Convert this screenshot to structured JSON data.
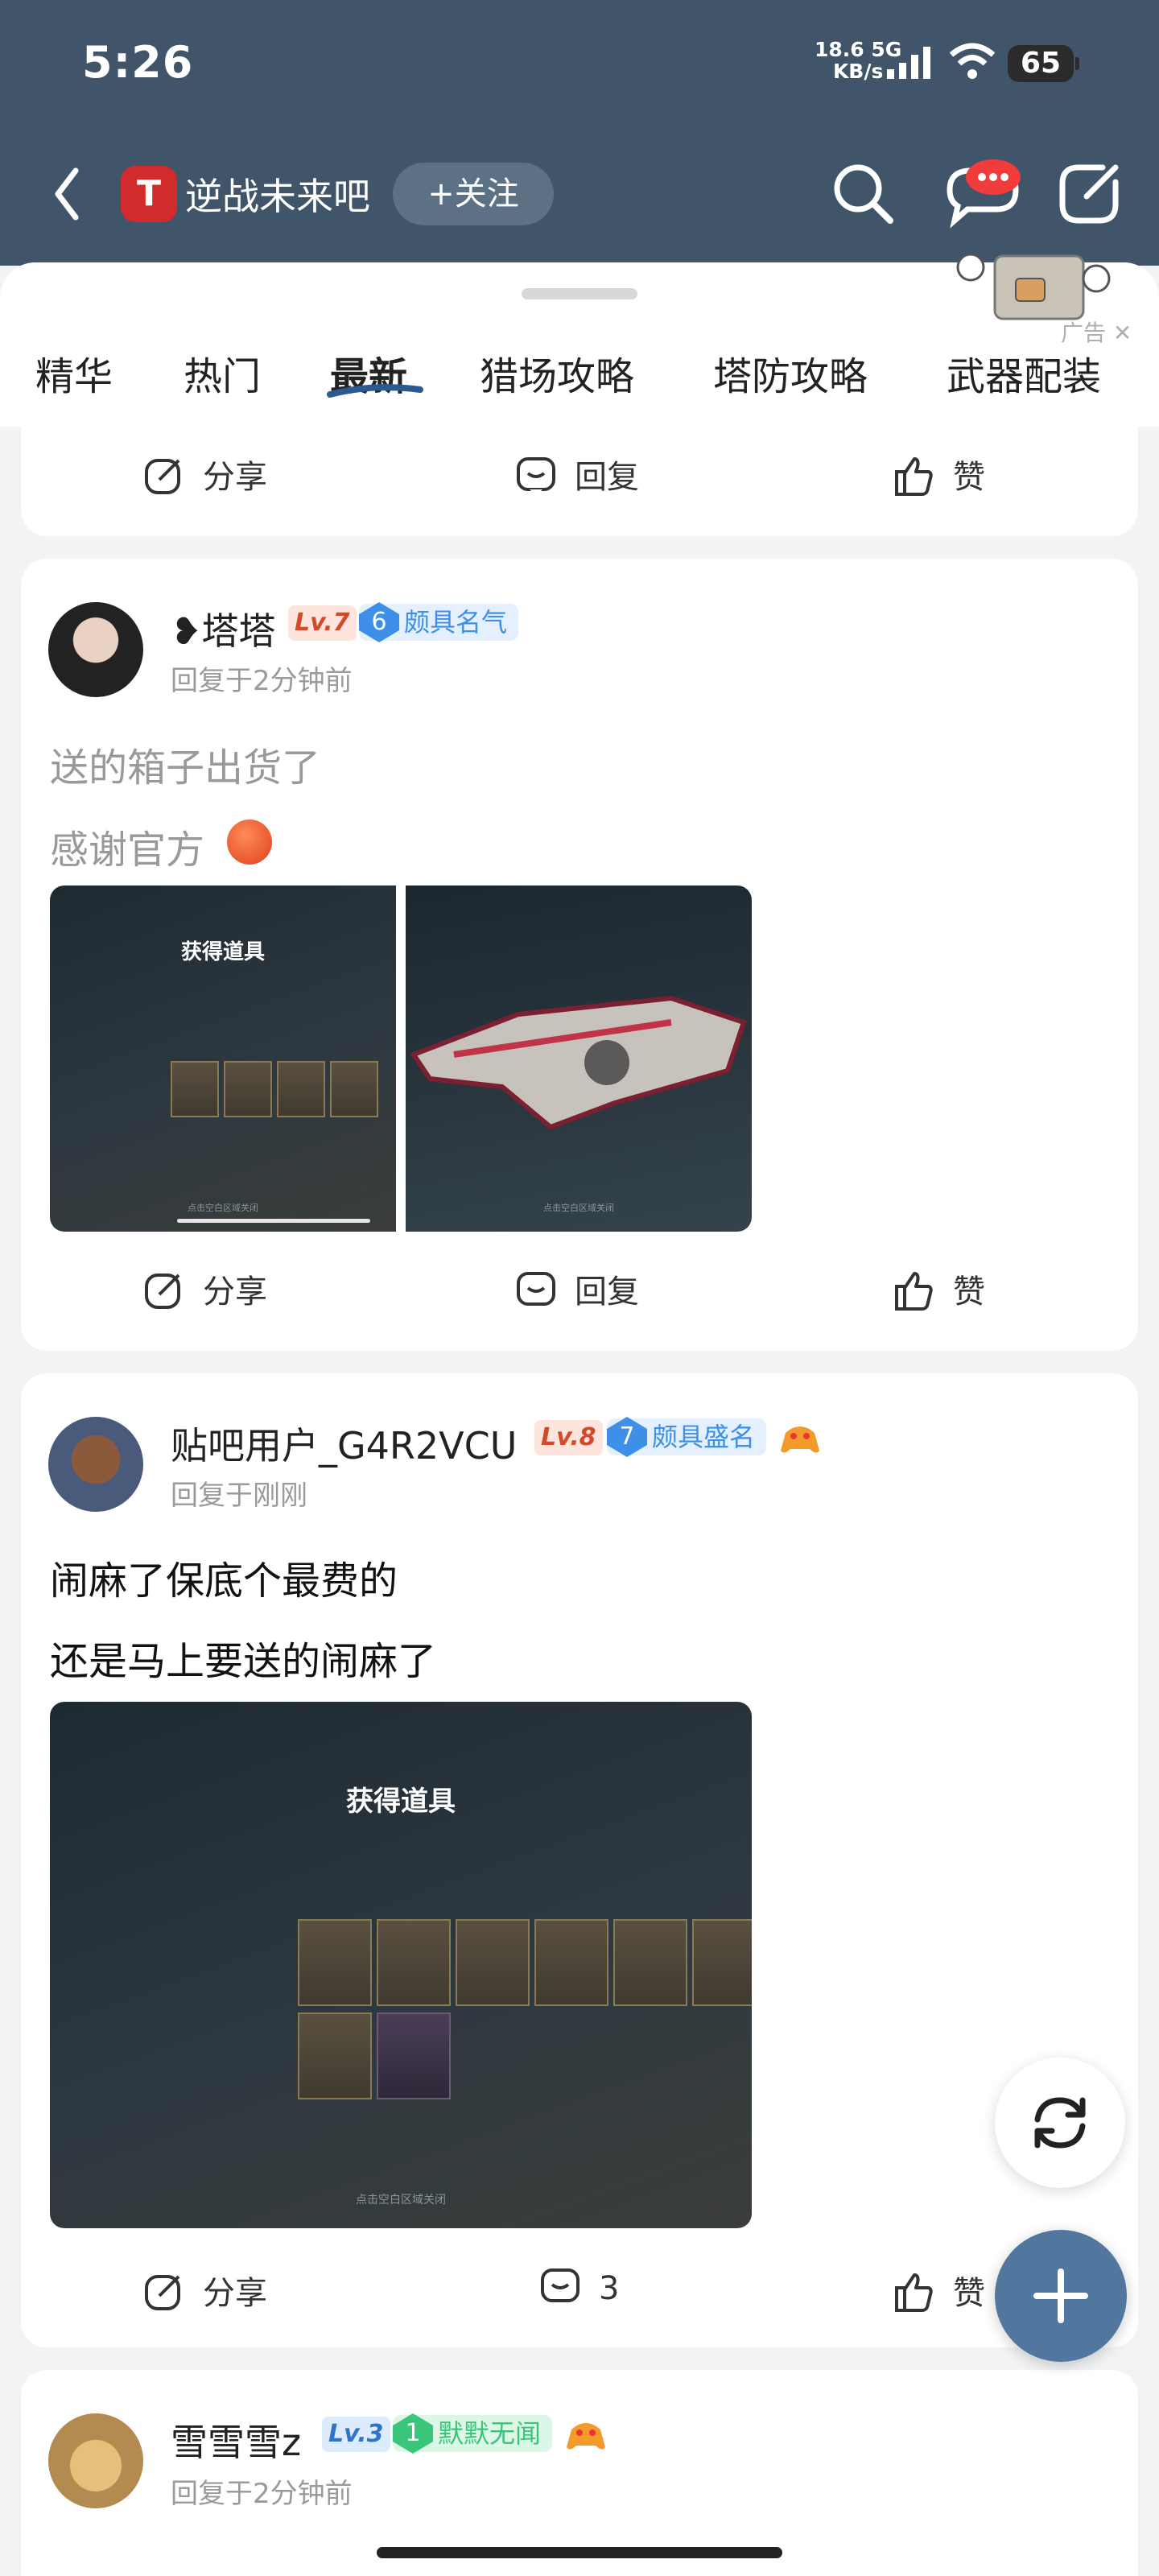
{
  "status_bar": {
    "time": "5:26",
    "net_speed": "18.6",
    "net_unit": "KB/s",
    "net_type": "5G",
    "battery": "65"
  },
  "header": {
    "title": "逆战未来吧",
    "follow_label": "+关注"
  },
  "tabs": [
    "精华",
    "热门",
    "最新",
    "猎场攻略",
    "塔防攻略",
    "武器配装"
  ],
  "active_tab": "最新",
  "ad_label": "广告",
  "actions": {
    "share": "分享",
    "reply": "回复",
    "like": "赞"
  },
  "posts": [
    {
      "user": "塔塔",
      "level": "Lv.7",
      "badge_num": "6",
      "badge_label": "颇具名气",
      "time": "回复于2分钟前",
      "lines": [
        "送的箱子出货了",
        "感谢官方"
      ],
      "images": [
        {
          "title": "获得道具",
          "caption": "点击空白区域关闭"
        },
        {
          "caption": "点击空白区域关闭"
        }
      ],
      "reply_label": "回复"
    },
    {
      "user": "贴吧用户_G4R2VCU",
      "level": "Lv.8",
      "badge_num": "7",
      "badge_label": "颇具盛名",
      "time": "回复于刚刚",
      "lines": [
        "闹麻了保底个最费的",
        "还是马上要送的闹麻了"
      ],
      "images": [
        {
          "title": "获得道具",
          "caption": "点击空白区域关闭"
        }
      ],
      "reply_count": "3"
    },
    {
      "user": "雪雪雪z",
      "level": "Lv.3",
      "badge_num": "1",
      "badge_label": "默默无闻",
      "time": "回复于2分钟前"
    }
  ],
  "colors": {
    "header_bg": "#405569",
    "fab_bg": "#52779e",
    "level_bg": "#fde4dc",
    "level_fg": "#d24a2a",
    "badge_blue": "#3d8fe8",
    "badge_green": "#39c57a"
  },
  "icons": [
    "back-icon",
    "search-icon",
    "messages-icon",
    "edit-icon",
    "share-icon",
    "reply-icon",
    "like-icon",
    "refresh-icon",
    "plus-icon"
  ]
}
